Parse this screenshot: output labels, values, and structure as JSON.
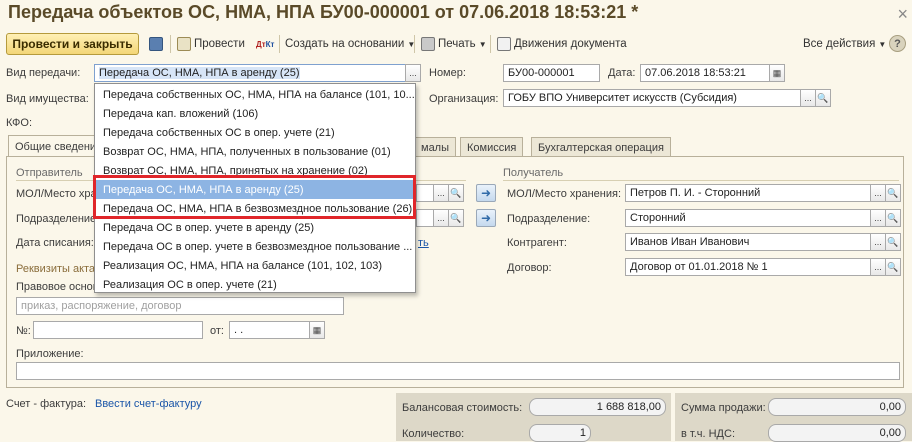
{
  "window": {
    "title": "Передача объектов ОС, НМА, НПА БУ00-000001 от 07.06.2018 18:53:21 *",
    "close": "×"
  },
  "toolbar": {
    "post_close": "Провести и закрыть",
    "post": "Провести",
    "create_based": "Создать на основании",
    "print": "Печать",
    "movements": "Движения документа",
    "all_actions": "Все действия",
    "help": "?"
  },
  "form": {
    "transfer_type_label": "Вид передачи:",
    "transfer_type_value": "Передача ОС, НМА, НПА в аренду (25)",
    "number_label": "Номер:",
    "number_value": "БУ00-000001",
    "date_label": "Дата:",
    "date_value": "07.06.2018 18:53:21",
    "property_type_label": "Вид имущества:",
    "org_label": "Организация:",
    "org_value": "ГОБУ ВПО Университет искусств (Субсидия)",
    "kfo_label": "КФО:"
  },
  "tabs": [
    {
      "label": "Общие сведения"
    },
    {
      "label": "малы"
    },
    {
      "label": "Комиссия"
    },
    {
      "label": "Бухгалтерская операция"
    }
  ],
  "sender": {
    "title": "Отправитель",
    "mol_label": "МОЛ/Место хранения:",
    "dept_label": "Подразделение:",
    "writeoff_date_label": "Дата списания:",
    "writeoff_link": "ть"
  },
  "receiver": {
    "title": "Получатель",
    "mol_label": "МОЛ/Место хранения:",
    "mol_value": "Петров П. И. - Сторонний",
    "dept_label": "Подразделение:",
    "dept_value": "Сторонний",
    "contractor_label": "Контрагент:",
    "contractor_value": "Иванов Иван Иванович",
    "contract_label": "Договор:",
    "contract_value": "Договор от 01.01.2018 № 1"
  },
  "act": {
    "title": "Реквизиты акта",
    "legal_basis_label": "Правовое основание:",
    "legal_basis_placeholder": "приказ, распоряжение, договор",
    "number_label": "№:",
    "from_label": "от:",
    "from_value": " .  .",
    "attachment_label": "Приложение:"
  },
  "invoice": {
    "label": "Счет - фактура:",
    "link": "Ввести счет-фактуру"
  },
  "totals": {
    "balance_label": "Балансовая стоимость:",
    "balance_value": "1 688 818,00",
    "qty_label": "Количество:",
    "qty_value": "1",
    "sale_label": "Сумма продажи:",
    "sale_value": "0,00",
    "vat_label": "в т.ч. НДС:",
    "vat_value": "0,00"
  },
  "dropdown": {
    "items": [
      "Передача собственных ОС, НМА, НПА на балансе (101, 10...",
      "Передача кап. вложений (106)",
      "Передача собственных ОС в опер. учете (21)",
      "Возврат ОС, НМА, НПА, полученных в пользование (01)",
      "Возврат ОС, НМА, НПА, принятых на хранение (02)",
      "Передача ОС, НМА, НПА в аренду (25)",
      "Передача ОС, НМА, НПА в безвозмездное пользование (26)",
      "Передача ОС в опер. учете в аренду (25)",
      "Передача ОС в опер. учете в безвозмездное пользование ...",
      "Реализация ОС, НМА, НПА на балансе (101, 102, 103)",
      "Реализация ОС в опер. учете (21)"
    ]
  },
  "colors": {
    "accent": "#f3d677",
    "selection": "#8db4e3",
    "highlight_border": "#e0262a",
    "link": "#1a55a8"
  },
  "icons": [
    "save-icon",
    "post-icon",
    "dt-kt-icon",
    "print-icon",
    "movements-icon",
    "calendar-icon",
    "search-icon",
    "arrow-right-icon"
  ]
}
